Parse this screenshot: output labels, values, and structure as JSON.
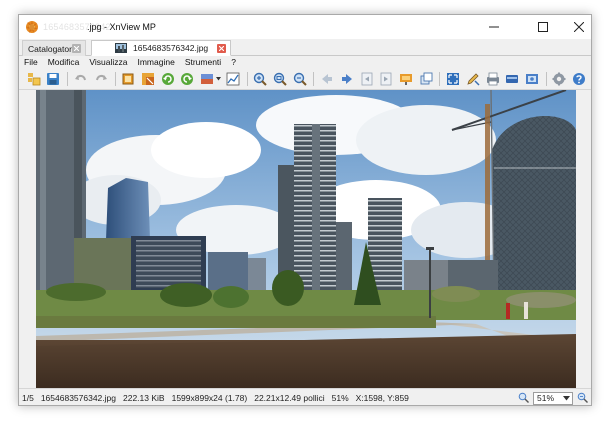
{
  "window": {
    "title": ".jpg - XnView MP",
    "title_ghost": "1654683576342"
  },
  "tabs": [
    {
      "label": "Catalogatore"
    },
    {
      "label": "1654683576342.jpg"
    }
  ],
  "menu": [
    "File",
    "Modifica",
    "Visualizza",
    "Immagine",
    "Strumenti",
    "?"
  ],
  "toolbar": {
    "icons": [
      "browse-icon",
      "save-icon",
      "undo-icon",
      "redo-icon",
      "crop-icon",
      "resize-icon",
      "rotate-left-icon",
      "rotate-right-icon",
      "adjust-icon",
      "histogram-icon",
      "zoom-in-icon",
      "zoom-fit-icon",
      "zoom-out-icon",
      "back-icon",
      "forward-icon",
      "first-page-icon",
      "last-page-icon",
      "slideshow-icon",
      "copy-icon",
      "fullscreen-icon",
      "edit-icon",
      "print-icon",
      "scanner-icon",
      "capture-icon",
      "settings-icon",
      "help-icon"
    ]
  },
  "status": {
    "index": "1/5",
    "filename": "1654683576342.jpg",
    "filesize": "222.13 KiB",
    "dimensions": "1599x899x24 (1.78)",
    "physical": "22.21x12.49 pollici",
    "zoom_percent": "51%",
    "cursor": "X:1598, Y:859",
    "zoom_value": "51%"
  },
  "colors": {
    "accent": "#0a5fb4",
    "close_red": "#e15b4c",
    "window_bg": "#f0f0f0"
  }
}
